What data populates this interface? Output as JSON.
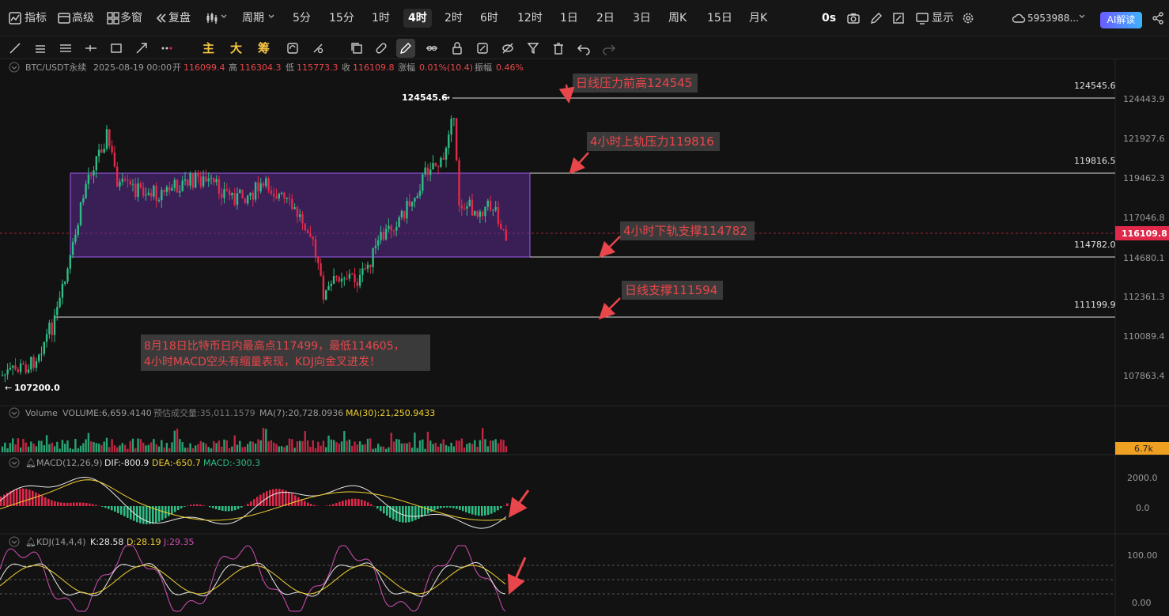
{
  "topbar": {
    "indicators": "指标",
    "advanced": "高级",
    "multi_window": "多窗",
    "replay": "复盘",
    "period": "周期",
    "intervals": [
      "5分",
      "15分",
      "1时",
      "4时",
      "2时",
      "6时",
      "12时",
      "1日",
      "2日",
      "3日",
      "周K",
      "15日",
      "月K"
    ],
    "active_interval": "4时",
    "countdown": "0s",
    "display": "显示",
    "account": "5953988...",
    "ai_button": "AI解读"
  },
  "drawbar": {
    "labels": [
      "主",
      "大",
      "筹"
    ]
  },
  "legend": {
    "symbol": "BTC/USDT永续",
    "datetime": "2025-08-19 00:00",
    "open_label": "开",
    "open": "116099.4",
    "high_label": "高",
    "high": "116304.3",
    "low_label": "低",
    "low": "115773.3",
    "close_label": "收",
    "close": "116109.8",
    "change_label": "涨幅",
    "change": "0.01%(10.4)",
    "amplitude_label": "振幅",
    "amplitude": "0.46%"
  },
  "price_axis": {
    "ticks": [
      "124443.9",
      "121927.6",
      "119462.3",
      "117046.8",
      "114680.1",
      "112361.3",
      "110089.4",
      "107863.4"
    ],
    "current_price": "116109.8"
  },
  "levels": [
    {
      "price_label": "124545.6",
      "note": "日线压力前高124545"
    },
    {
      "price_label": "119816.5",
      "note": "4小时上轨压力119816"
    },
    {
      "price_label": "114782.0",
      "note": "4小时下轨支撑114782"
    },
    {
      "price_label": "111199.9",
      "note": "日线支撑111594"
    }
  ],
  "marks": {
    "high_marker": "124545.6",
    "low_marker": "107200.0"
  },
  "commentary": {
    "line1": "8月18日比特币日内最高点117499，最低114605，",
    "line2": "4小时MACD空头有缩量表现，KDJ向金叉进发！"
  },
  "volume_panel": {
    "title": "Volume",
    "volume": "VOLUME:6,659.4140",
    "estimate": "预估成交量:35,011.1579",
    "ma7": "MA(7):20,728.0936",
    "ma30": "MA(30):21,250.9433",
    "axis_label": "6.7k"
  },
  "macd_panel": {
    "title": "MACD(12,26,9)",
    "dif": "DIF:-800.9",
    "dea": "DEA:-650.7",
    "macd": "MACD:-300.3",
    "ticks": [
      "2000.0",
      "0.0"
    ]
  },
  "kdj_panel": {
    "title": "KDJ(14,4,4)",
    "k": "K:28.58",
    "d": "D:28.19",
    "j": "J:29.35",
    "ticks": [
      "100.00",
      "0.00"
    ]
  },
  "colors": {
    "up": "#2ebd85",
    "down": "#e0294a",
    "box_fill": "#5b2a8e",
    "annotation_red": "#e8464a",
    "macd_dif": "#e8e8e8",
    "macd_dea": "#f0d030",
    "kdj_k": "#e8e8e8",
    "kdj_d": "#f0d030",
    "kdj_j": "#d04fb5"
  }
}
